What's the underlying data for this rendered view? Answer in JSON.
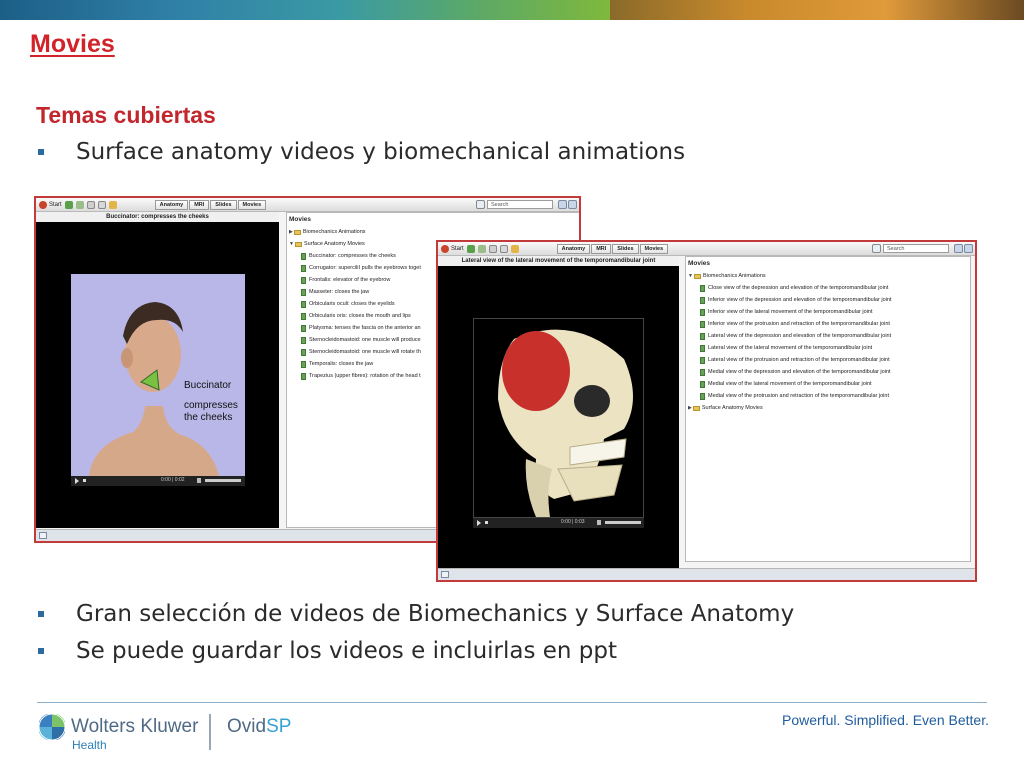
{
  "slide": {
    "title": "Movies",
    "subtitle": "Temas cubiertas",
    "bullets": [
      "Surface anatomy videos y biomechanical animations",
      "Gran selección de videos de Biomechanics y Surface Anatomy",
      "Se puede guardar los videos e incluirlas en ppt"
    ],
    "colors": {
      "title": "#d2232a",
      "bullet": "#2d6b9e",
      "tagline": "#1f5c9e"
    }
  },
  "app1": {
    "toolbar": {
      "start": "Start",
      "tabs": [
        "Anatomy",
        "MRI",
        "Slides",
        "Movies"
      ],
      "search_placeholder": "Search"
    },
    "video_title": "Buccinator: compresses the cheeks",
    "video_caption": [
      "Buccinator",
      "compresses",
      "the cheeks"
    ],
    "player_time": "0:00 | 0:02",
    "panel_title": "Movies",
    "tree": {
      "folder1": "Biomechanics Animations",
      "folder2": "Surface Anatomy Movies",
      "items": [
        "Buccinator: compresses the cheeks",
        "Corrugator: superciliI pulls the eyebrows toget",
        "Frontalis: elevator of the eyebrow",
        "Masseter: closes the jaw",
        "Orbicularis oculi: closes the eyelids",
        "Orbicularis oris: closes the mouth and lips",
        "Platysma: tenses the fascia on the anterior an",
        "Sternocleidomastoid: one muscle will produce",
        "Sternocleidomastoid: one muscle will rotate th",
        "Temporalis: closes the jaw",
        "Trapezius (upper fibres): rotation of the head t"
      ]
    }
  },
  "app2": {
    "toolbar": {
      "start": "Start",
      "tabs": [
        "Anatomy",
        "MRI",
        "Slides",
        "Movies"
      ],
      "search_placeholder": "Search"
    },
    "video_title": "Lateral view of the lateral movement of the temporomandibular joint",
    "player_time": "0:00 | 0:03",
    "panel_title": "Movies",
    "tree": {
      "folder1": "Biomechanics Animations",
      "folder2": "Surface Anatomy Movies",
      "items": [
        "Close view of the depression and elevation of the temporomandibular joint",
        "Inferior view of the depression and elevation of the temporomandibular joint",
        "Inferior view of the lateral movement of the temporomandibular joint",
        "Inferior view of the protrusion and retraction of the temporomandibular joint",
        "Lateral view of the depression and elevation of the temporomandibular joint",
        "Lateral view of the lateral movement of the temporomandibular joint",
        "Lateral view of the protrusion and retraction of the temporomandibular joint",
        "Medial view of the depression and elevation of the temporomandibular joint",
        "Medial view of the lateral movement of the temporomandibular joint",
        "Medial view of the protrusion and retraction of the temporomandibular joint"
      ]
    }
  },
  "footer": {
    "brand": "Wolters Kluwer",
    "division": "Health",
    "product_prefix": "Ovid",
    "product_suffix": "SP",
    "tagline": "Powerful. Simplified. Even Better."
  }
}
